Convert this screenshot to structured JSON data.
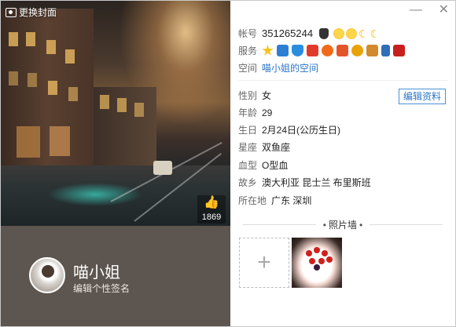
{
  "cover": {
    "change_label": "更换封面",
    "likes": "1869"
  },
  "profile": {
    "nickname": "喵小姐",
    "signature_placeholder": "编辑个性签名"
  },
  "info": {
    "qq_label": "帐号",
    "qq_number": "351265244",
    "service_label": "服务",
    "space_label": "空间",
    "space_name": "喵小姐的空间",
    "gender_label": "性别",
    "gender": "女",
    "age_label": "年龄",
    "age": "29",
    "birthday_label": "生日",
    "birthday": "2月24日(公历生日)",
    "zodiac_label": "星座",
    "zodiac": "双鱼座",
    "blood_label": "血型",
    "blood": "O型血",
    "hometown_label": "故乡",
    "hometown": "澳大利亚 昆士兰 布里斯班",
    "location_label": "所在地",
    "location": "广东 深圳",
    "edit_button": "编辑资料"
  },
  "photos": {
    "title": "照片墙"
  },
  "level_icons": [
    "penguin-icon",
    "sun-icon",
    "sun-icon",
    "moon-icon",
    "moon-icon"
  ],
  "service_icons": [
    "star-icon",
    "camera-icon",
    "shield-icon",
    "video-icon",
    "music-icon",
    "game-icon",
    "coin-icon",
    "pet-icon",
    "phone-icon",
    "badge-icon"
  ],
  "colors": {
    "link": "#2a75c8",
    "profile_bg": "#5d554f",
    "button_border": "#4a90d9"
  }
}
